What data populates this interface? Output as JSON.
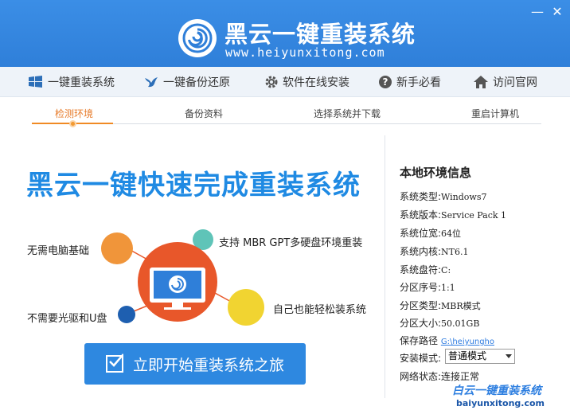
{
  "header": {
    "title": "黑云一键重装系统",
    "url": "www.heiyunxitong.com",
    "minimize_label": "—",
    "close_label": "✕"
  },
  "nav": [
    {
      "label": "一键重装系统",
      "icon": "windows-logo-icon"
    },
    {
      "label": "一键备份还原",
      "icon": "bird-icon"
    },
    {
      "label": "软件在线安装",
      "icon": "gear-icon"
    },
    {
      "label": "新手必看",
      "icon": "question-icon"
    },
    {
      "label": "访问官网",
      "icon": "home-icon"
    }
  ],
  "steps": [
    "检测环境",
    "备份资料",
    "选择系统并下载",
    "重启计算机"
  ],
  "main": {
    "headline": "黑云一键快速完成重装系统",
    "features": {
      "no_basics": "无需电脑基础",
      "mbr_gpt": "支持 MBR GPT多硬盘环境重装",
      "no_drive": "不需要光驱和U盘",
      "easy": "自己也能轻松装系统"
    },
    "cta_label": "立即开始重装系统之旅"
  },
  "info": {
    "title": "本地环境信息",
    "rows": [
      {
        "label": "系统类型:",
        "value": "Windows7"
      },
      {
        "label": "系统版本:",
        "value": "Service Pack 1"
      },
      {
        "label": "系统位宽:",
        "value": "64位"
      },
      {
        "label": "系统内核:",
        "value": "NT6.1"
      },
      {
        "label": "系统盘符:",
        "value": "C:"
      },
      {
        "label": "分区序号:",
        "value": "1:1"
      },
      {
        "label": "分区类型:",
        "value": "MBR模式"
      },
      {
        "label": "分区大小:",
        "value": "50.01GB"
      },
      {
        "label": "保存路径",
        "value": "G:\\heiyungho"
      },
      {
        "label": "安装模式:",
        "value": "普通模式"
      },
      {
        "label": "网络状态:",
        "value": "连接正常"
      }
    ]
  },
  "watermark": {
    "line1": "白云一键重装系统",
    "line2": "baiyunxitong.com"
  },
  "colors": {
    "header_blue": "#2f7fd9",
    "accent_orange": "#e8572a",
    "headline_blue": "#1f8ae3"
  }
}
